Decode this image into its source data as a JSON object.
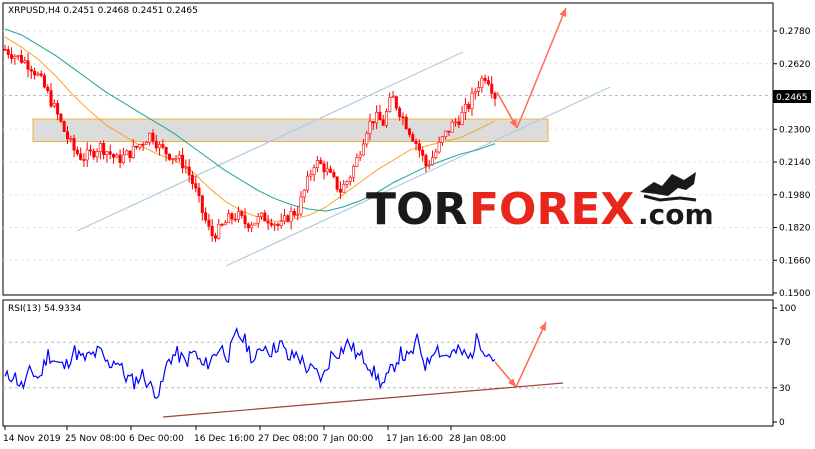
{
  "header": {
    "symbol_line": "XRPUSD,H4  0.2451 0.2468 0.2451 0.2465"
  },
  "watermark": {
    "part1": "TOR",
    "part2": "FOREX",
    "part3": ".com",
    "icon": "bull-bear-icon"
  },
  "colors": {
    "candle": "#ff0000",
    "ma_fast": "#f5a623",
    "ma_slow": "#1aa59a",
    "channel": "#b0cce0",
    "zone_fill": "#d9d9d9",
    "zone_border": "#f5a623",
    "arrow": "#ff6a55",
    "rsi_line": "#0000ff",
    "rsi_trend": "#a0413a",
    "wm_dark": "#1a1a1a",
    "wm_red": "#e8261c"
  },
  "chart_data": [
    {
      "type": "candlestick",
      "symbol": "XRPUSD",
      "timeframe": "H4",
      "ohlc_last": {
        "open": 0.2451,
        "high": 0.2468,
        "low": 0.2451,
        "close": 0.2465
      },
      "current_price_label": "0.2465",
      "y_ticks": [
        "0.2780",
        "0.2620",
        "0.2465",
        "0.2300",
        "0.2140",
        "0.1980",
        "0.1820",
        "0.1660",
        "0.1500"
      ],
      "ylim": [
        0.15,
        0.288
      ],
      "x_ticks": [
        "14 Nov 2019",
        "25 Nov 08:00",
        "6 Dec 00:00",
        "16 Dec 16:00",
        "27 Dec 08:00",
        "7 Jan 00:00",
        "17 Jan 16:00",
        "28 Jan 08:00"
      ],
      "close_series": [
        0.269,
        0.2665,
        0.264,
        0.261,
        0.255,
        0.247,
        0.238,
        0.228,
        0.22,
        0.216,
        0.218,
        0.222,
        0.219,
        0.215,
        0.217,
        0.22,
        0.224,
        0.228,
        0.221,
        0.218,
        0.216,
        0.212,
        0.202,
        0.189,
        0.178,
        0.181,
        0.186,
        0.188,
        0.184,
        0.185,
        0.187,
        0.186,
        0.182,
        0.188,
        0.19,
        0.202,
        0.214,
        0.212,
        0.206,
        0.2,
        0.206,
        0.216,
        0.23,
        0.236,
        0.233,
        0.246,
        0.238,
        0.23,
        0.222,
        0.212,
        0.218,
        0.226,
        0.232,
        0.236,
        0.242,
        0.252,
        0.257,
        0.2465
      ],
      "moving_averages": [
        {
          "values": [
            0.275,
            0.27,
            0.264,
            0.256,
            0.247,
            0.239,
            0.232,
            0.227,
            0.222,
            0.218,
            0.215,
            0.21,
            0.202,
            0.195,
            0.19,
            0.187,
            0.185,
            0.186,
            0.188,
            0.192,
            0.198,
            0.204,
            0.21,
            0.215,
            0.22,
            0.222,
            0.224,
            0.226,
            0.23,
            0.234
          ]
        },
        {
          "values": [
            0.279,
            0.276,
            0.271,
            0.266,
            0.26,
            0.254,
            0.248,
            0.243,
            0.238,
            0.233,
            0.228,
            0.222,
            0.216,
            0.21,
            0.205,
            0.2,
            0.196,
            0.193,
            0.191,
            0.19,
            0.192,
            0.195,
            0.199,
            0.204,
            0.208,
            0.212,
            0.215,
            0.218,
            0.22,
            0.223
          ]
        }
      ],
      "resistance_zone": [
        0.224,
        0.235
      ],
      "annotation": "expected move: pullback to zone then rise"
    },
    {
      "type": "line",
      "indicator": "RSI(13)",
      "label": "RSI(13) 54.9334",
      "value": 54.9334,
      "y_ticks": [
        "100",
        "70",
        "30",
        "0"
      ],
      "ylim": [
        0,
        100
      ],
      "values": [
        38,
        42,
        30,
        45,
        38,
        60,
        52,
        48,
        63,
        55,
        58,
        62,
        50,
        55,
        40,
        35,
        42,
        30,
        25,
        55,
        60,
        52,
        62,
        48,
        55,
        66,
        58,
        78,
        70,
        52,
        68,
        62,
        70,
        55,
        60,
        48,
        44,
        38,
        60,
        62,
        70,
        58,
        55,
        42,
        32,
        46,
        60,
        55,
        72,
        48,
        68,
        58,
        60,
        62,
        55,
        74,
        62,
        55
      ]
    }
  ]
}
